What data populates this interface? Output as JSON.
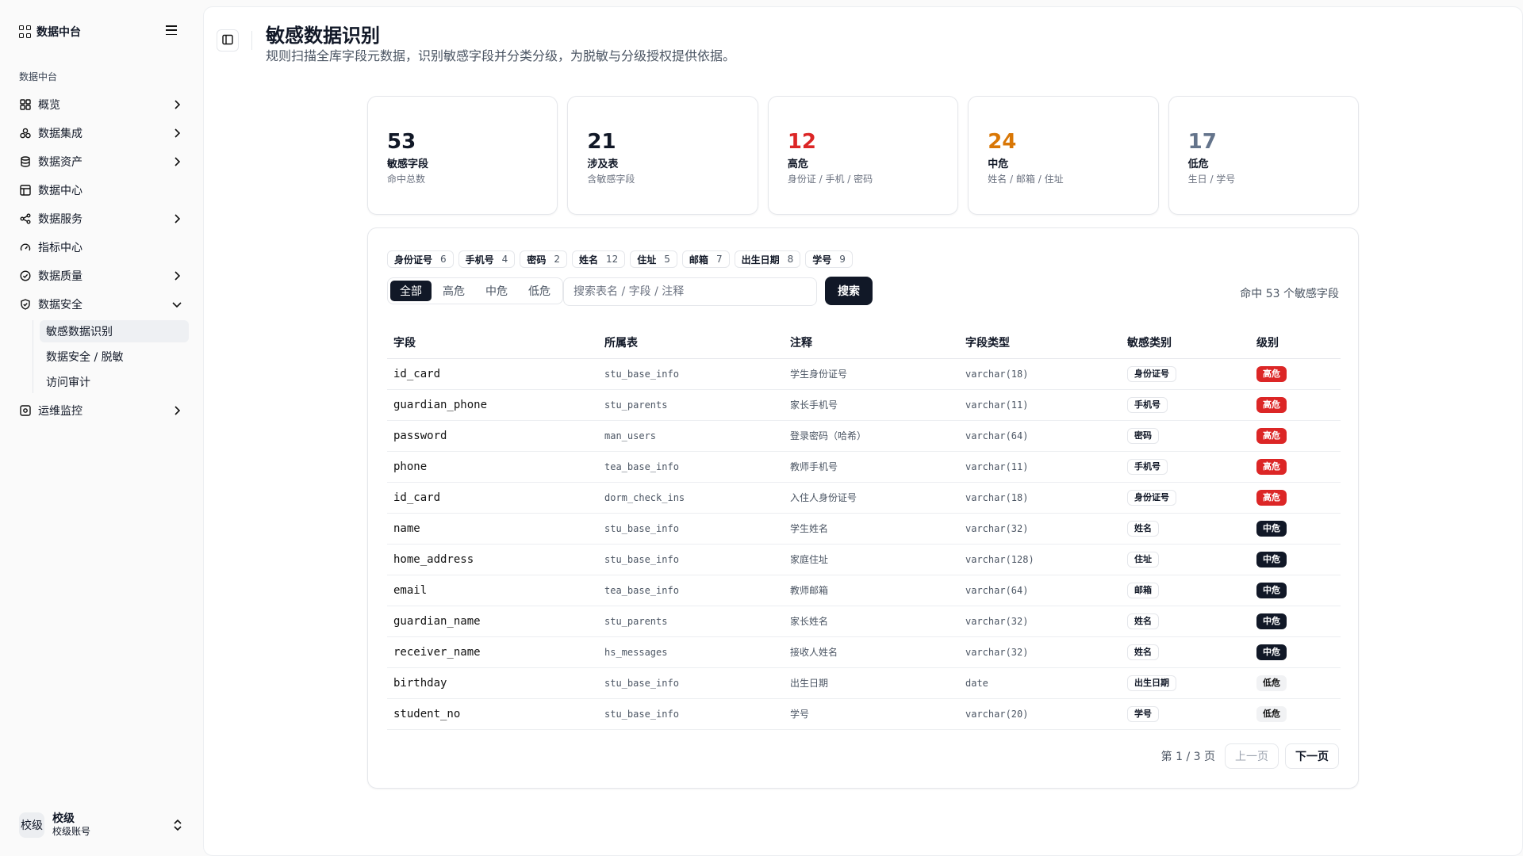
{
  "sidebar": {
    "brand": "数据中台",
    "group_label": "数据中台",
    "items": [
      {
        "label": "概览"
      },
      {
        "label": "数据集成"
      },
      {
        "label": "数据资产"
      },
      {
        "label": "数据中心"
      },
      {
        "label": "数据服务"
      },
      {
        "label": "指标中心"
      },
      {
        "label": "数据质量"
      },
      {
        "label": "数据安全"
      },
      {
        "label": "运维监控"
      }
    ],
    "security_sub": [
      {
        "label": "敏感数据识别"
      },
      {
        "label": "数据安全 / 脱敏"
      },
      {
        "label": "访问审计"
      }
    ],
    "user": {
      "avatar": "校级",
      "name": "校级",
      "role": "校级账号"
    }
  },
  "header": {
    "title": "敏感数据识别",
    "subtitle": "规则扫描全库字段元数据，识别敏感字段并分类分级，为脱敏与分级授权提供依据。"
  },
  "stats": [
    {
      "value": "53",
      "label": "敏感字段",
      "hint": "命中总数",
      "color": "#111827"
    },
    {
      "value": "21",
      "label": "涉及表",
      "hint": "含敏感字段",
      "color": "#111827"
    },
    {
      "value": "12",
      "label": "高危",
      "hint": "身份证 / 手机 / 密码",
      "color": "#dc2626"
    },
    {
      "value": "24",
      "label": "中危",
      "hint": "姓名 / 邮箱 / 住址",
      "color": "#d97706"
    },
    {
      "value": "17",
      "label": "低危",
      "hint": "生日 / 学号",
      "color": "#64748b"
    }
  ],
  "chips": [
    {
      "name": "身份证号",
      "count": "6"
    },
    {
      "name": "手机号",
      "count": "4"
    },
    {
      "name": "密码",
      "count": "2"
    },
    {
      "name": "姓名",
      "count": "12"
    },
    {
      "name": "住址",
      "count": "5"
    },
    {
      "name": "邮箱",
      "count": "7"
    },
    {
      "name": "出生日期",
      "count": "8"
    },
    {
      "name": "学号",
      "count": "9"
    }
  ],
  "filter": {
    "tabs": [
      "全部",
      "高危",
      "中危",
      "低危"
    ],
    "active": "全部",
    "search_placeholder": "搜索表名 / 字段 / 注释",
    "search_button": "搜索",
    "hits": "命中 53 个敏感字段"
  },
  "table": {
    "headers": [
      "字段",
      "所属表",
      "注释",
      "字段类型",
      "敏感类别",
      "级别"
    ],
    "rows": [
      {
        "field": "id_card",
        "table": "stu_base_info",
        "comment": "学生身份证号",
        "type": "varchar(18)",
        "category": "身份证号",
        "level": "高危",
        "lv": "high"
      },
      {
        "field": "guardian_phone",
        "table": "stu_parents",
        "comment": "家长手机号",
        "type": "varchar(11)",
        "category": "手机号",
        "level": "高危",
        "lv": "high"
      },
      {
        "field": "password",
        "table": "man_users",
        "comment": "登录密码（哈希）",
        "type": "varchar(64)",
        "category": "密码",
        "level": "高危",
        "lv": "high"
      },
      {
        "field": "phone",
        "table": "tea_base_info",
        "comment": "教师手机号",
        "type": "varchar(11)",
        "category": "手机号",
        "level": "高危",
        "lv": "high"
      },
      {
        "field": "id_card",
        "table": "dorm_check_ins",
        "comment": "入住人身份证号",
        "type": "varchar(18)",
        "category": "身份证号",
        "level": "高危",
        "lv": "high"
      },
      {
        "field": "name",
        "table": "stu_base_info",
        "comment": "学生姓名",
        "type": "varchar(32)",
        "category": "姓名",
        "level": "中危",
        "lv": "mid"
      },
      {
        "field": "home_address",
        "table": "stu_base_info",
        "comment": "家庭住址",
        "type": "varchar(128)",
        "category": "住址",
        "level": "中危",
        "lv": "mid"
      },
      {
        "field": "email",
        "table": "tea_base_info",
        "comment": "教师邮箱",
        "type": "varchar(64)",
        "category": "邮箱",
        "level": "中危",
        "lv": "mid"
      },
      {
        "field": "guardian_name",
        "table": "stu_parents",
        "comment": "家长姓名",
        "type": "varchar(32)",
        "category": "姓名",
        "level": "中危",
        "lv": "mid"
      },
      {
        "field": "receiver_name",
        "table": "hs_messages",
        "comment": "接收人姓名",
        "type": "varchar(32)",
        "category": "姓名",
        "level": "中危",
        "lv": "mid"
      },
      {
        "field": "birthday",
        "table": "stu_base_info",
        "comment": "出生日期",
        "type": "date",
        "category": "出生日期",
        "level": "低危",
        "lv": "low"
      },
      {
        "field": "student_no",
        "table": "stu_base_info",
        "comment": "学号",
        "type": "varchar(20)",
        "category": "学号",
        "level": "低危",
        "lv": "low"
      }
    ]
  },
  "pager": {
    "info": "第 1 / 3 页",
    "prev": "上一页",
    "next": "下一页"
  }
}
